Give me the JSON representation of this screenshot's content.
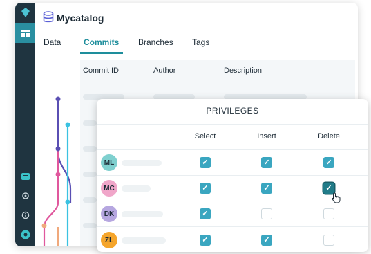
{
  "app": {
    "catalog_title": "Mycatalog"
  },
  "tabs": [
    {
      "label": "Data"
    },
    {
      "label": "Commits"
    },
    {
      "label": "Branches"
    },
    {
      "label": "Tags"
    }
  ],
  "commits_table": {
    "headers": [
      "Commit ID",
      "Author",
      "Description"
    ]
  },
  "privileges": {
    "title": "PRIVILEGES",
    "columns": [
      "Select",
      "Insert",
      "Delete"
    ],
    "rows": [
      {
        "initials": "ML",
        "avatar_color": "#7fd0cf",
        "select": true,
        "insert": true,
        "delete": true
      },
      {
        "initials": "MC",
        "avatar_color": "#f0a6c9",
        "select": true,
        "insert": true,
        "delete": true
      },
      {
        "initials": "DK",
        "avatar_color": "#b6a7e0",
        "select": true,
        "insert": false,
        "delete": false
      },
      {
        "initials": "ZL",
        "avatar_color": "#f5a52b",
        "select": true,
        "insert": true,
        "delete": false
      }
    ]
  },
  "colors": {
    "accent": "#1e8e9c",
    "checkbox_on": "#3aa6c0",
    "rail": "#1f3440"
  },
  "icons": [
    "diamond-logo-icon",
    "grid-icon",
    "catalog-stack-icon",
    "panel-icon",
    "gear-icon",
    "info-icon",
    "user-avatar-icon",
    "hand-cursor-icon"
  ]
}
